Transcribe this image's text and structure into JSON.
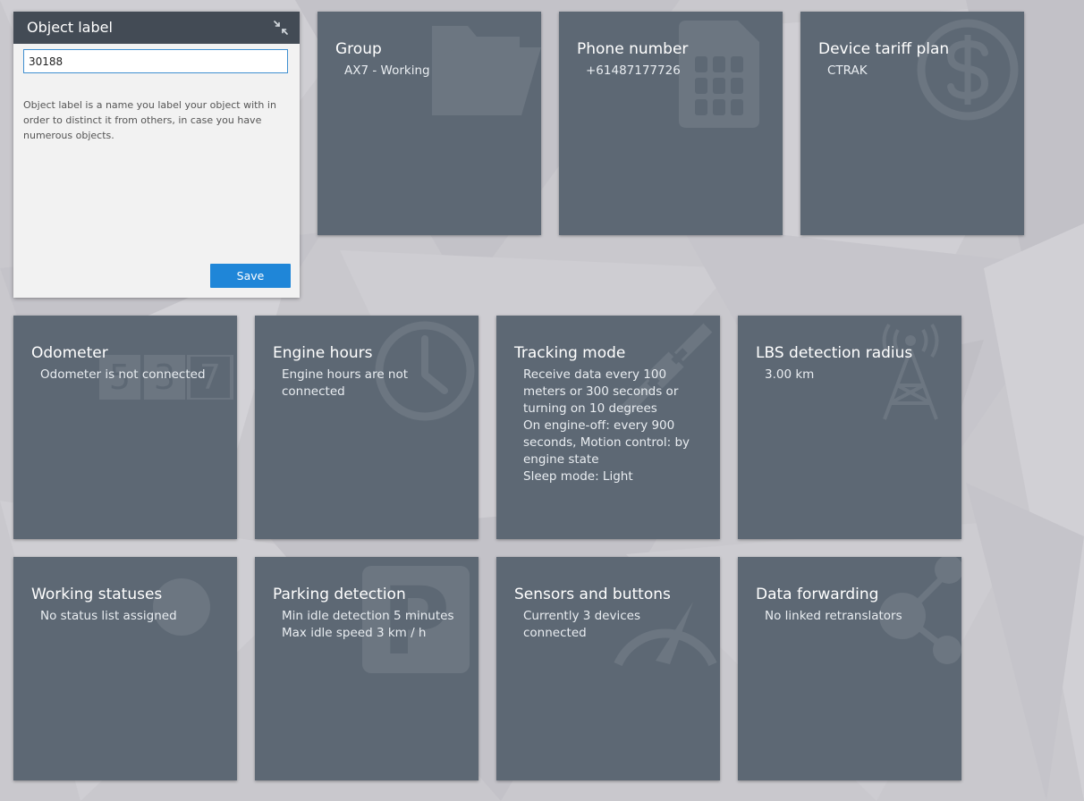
{
  "panel": {
    "title": "Object label",
    "input_value": "30188",
    "help_text": "Object label is a name you label your object with in order to distinct it from others, in case you have numerous objects.",
    "save_label": "Save"
  },
  "tiles": {
    "group": {
      "title": "Group",
      "lines": [
        "AX7 - Working"
      ]
    },
    "phone": {
      "title": "Phone number",
      "lines": [
        "+61487177726"
      ]
    },
    "tariff": {
      "title": "Device tariff plan",
      "lines": [
        "CTRAK"
      ]
    },
    "odometer": {
      "title": "Odometer",
      "lines": [
        "Odometer is not connected"
      ],
      "icon_digits": [
        "5",
        "3",
        "7"
      ]
    },
    "engine": {
      "title": "Engine hours",
      "lines": [
        "Engine hours are not connected"
      ]
    },
    "tracking": {
      "title": "Tracking mode",
      "lines": [
        "Receive data every 100 meters or 300 seconds or turning on 10 degrees",
        "On engine-off: every 900 seconds, Motion control: by engine state",
        "Sleep mode: Light"
      ]
    },
    "lbs": {
      "title": "LBS detection radius",
      "lines": [
        "3.00 km"
      ]
    },
    "working": {
      "title": "Working statuses",
      "lines": [
        "No status list assigned"
      ]
    },
    "parking": {
      "title": "Parking detection",
      "lines": [
        "Min idle detection 5 minutes",
        "Max idle speed 3 km / h"
      ],
      "icon_letter": "P"
    },
    "sensors": {
      "title": "Sensors and buttons",
      "lines": [
        "Currently 3 devices connected"
      ]
    },
    "forwarding": {
      "title": "Data forwarding",
      "lines": [
        "No linked retranslators"
      ]
    }
  },
  "icons": {
    "panel": [
      "minimize-icon"
    ],
    "tiles": [
      "folder-icon",
      "sim-card-icon",
      "dollar-coin-icon",
      "odometer-icon",
      "clock-icon",
      "satellite-icon",
      "cell-tower-icon",
      "status-circle-icon",
      "parking-icon",
      "gauge-icon",
      "share-icon"
    ]
  },
  "colors": {
    "tile_bg": "#5d6874",
    "panel_header": "#434b55",
    "accent": "#1f86d8",
    "page_bg": "#c9c8cd"
  }
}
